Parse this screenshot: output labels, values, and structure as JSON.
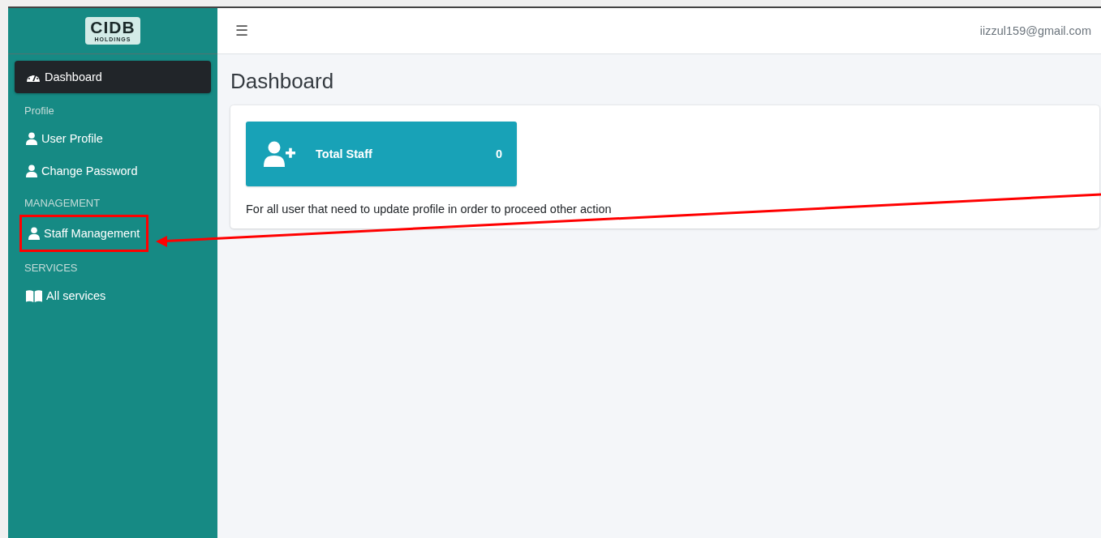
{
  "sidebar": {
    "logo": {
      "title": "CIDB",
      "subtitle": "HOLDINGS"
    },
    "items": [
      {
        "kind": "link",
        "label": "Dashboard",
        "selected": true,
        "highlighted": false
      },
      {
        "kind": "header",
        "label": "Profile"
      },
      {
        "kind": "link",
        "label": "User Profile",
        "selected": false,
        "highlighted": false
      },
      {
        "kind": "link",
        "label": "Change Password",
        "selected": false,
        "highlighted": false
      },
      {
        "kind": "header",
        "label": "MANAGEMENT"
      },
      {
        "kind": "link",
        "label": "Staff Management",
        "selected": false,
        "highlighted": true
      },
      {
        "kind": "header",
        "label": "SERVICES"
      },
      {
        "kind": "link",
        "label": "All services",
        "selected": false,
        "highlighted": false
      }
    ]
  },
  "header": {
    "menu_icon": "☰",
    "user_email": "iizzul159@gmail.com"
  },
  "page": {
    "title": "Dashboard",
    "info_box": {
      "label": "Total Staff",
      "value": "0"
    },
    "note": "For all user that need to update profile in order to proceed other action"
  }
}
